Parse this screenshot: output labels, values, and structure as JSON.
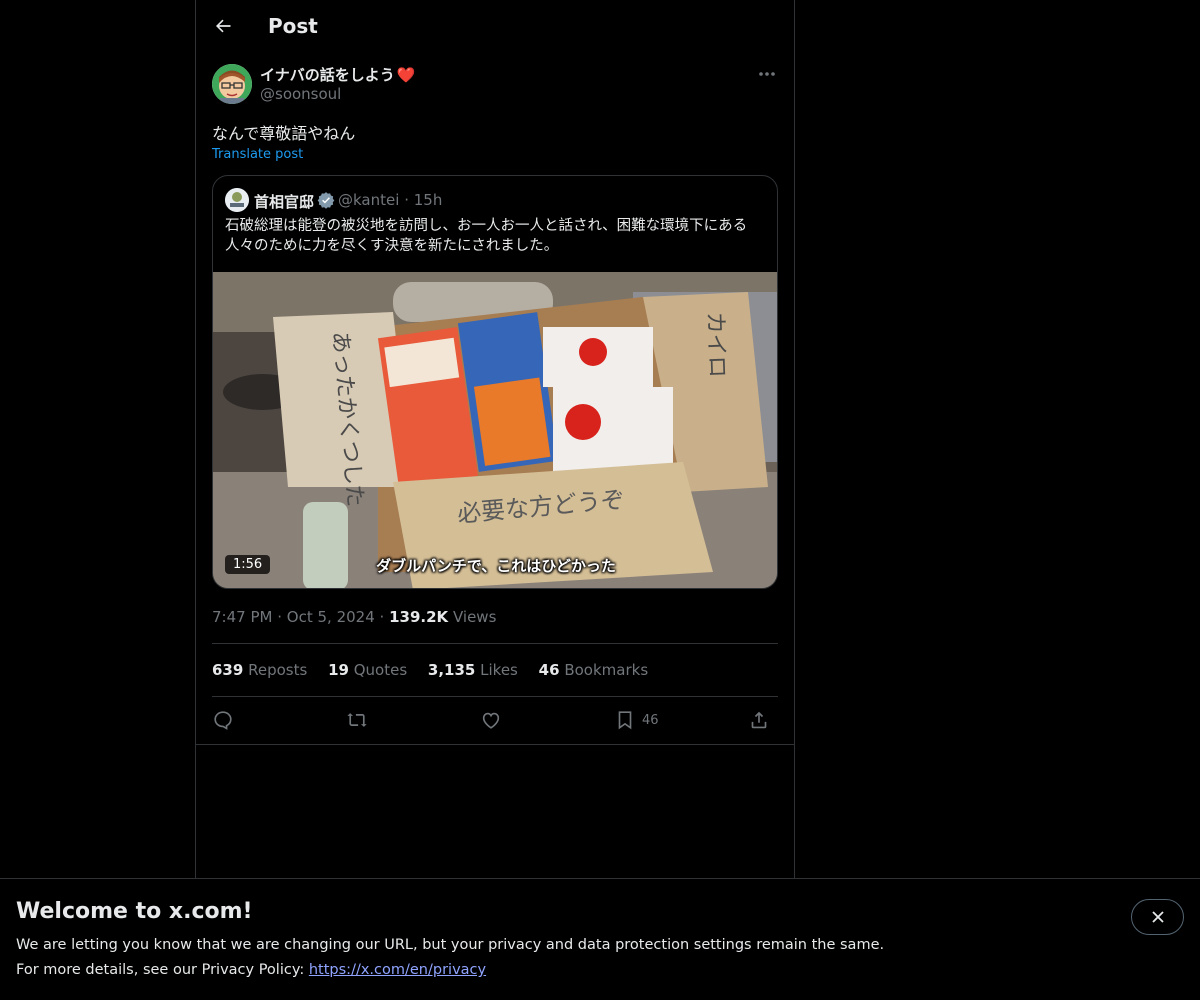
{
  "header": {
    "title": "Post"
  },
  "author": {
    "display_name": "イナバの話をしよう",
    "name_emoji": "❤️",
    "handle": "@soonsoul"
  },
  "post": {
    "text": "なんで尊敬語やねん",
    "translate_label": "Translate post"
  },
  "quoted": {
    "name": "首相官邸",
    "handle": "@kantei",
    "separator": "·",
    "time": "15h",
    "text": "石破総理は能登の被災地を訪問し、お一人お一人と話され、困難な環境下にある人々のために力を尽くす決意を新たにされました。",
    "video_duration": "1:56",
    "video_subtitle": "ダブルパンチで、これはひどかった",
    "box_labels": {
      "left_flap": "あったかくつした",
      "right_flap": "カイロ",
      "front": "必要な方どうぞ"
    }
  },
  "meta": {
    "time": "7:47 PM",
    "sep1": "·",
    "date": "Oct 5, 2024",
    "sep2": "·",
    "views_count": "139.2K",
    "views_label": "Views"
  },
  "stats": {
    "reposts_count": "639",
    "reposts_label": "Reposts",
    "quotes_count": "19",
    "quotes_label": "Quotes",
    "likes_count": "3,135",
    "likes_label": "Likes",
    "bookmarks_count": "46",
    "bookmarks_label": "Bookmarks"
  },
  "actions": {
    "bookmark_count": "46",
    "icons": [
      "reply-icon",
      "repost-icon",
      "like-icon",
      "bookmark-icon",
      "share-icon"
    ]
  },
  "banner": {
    "title": "Welcome to x.com!",
    "line1": "We are letting you know that we are changing our URL, but your privacy and data protection settings remain the same.",
    "line2_prefix": "For more details, see our Privacy Policy: ",
    "link": "https://x.com/en/privacy"
  },
  "colors": {
    "background": "#000000",
    "text": "#e7e9ea",
    "muted": "#71767b",
    "accent": "#1d9bf0",
    "border": "#2f3336",
    "link": "#8fa3ff"
  }
}
